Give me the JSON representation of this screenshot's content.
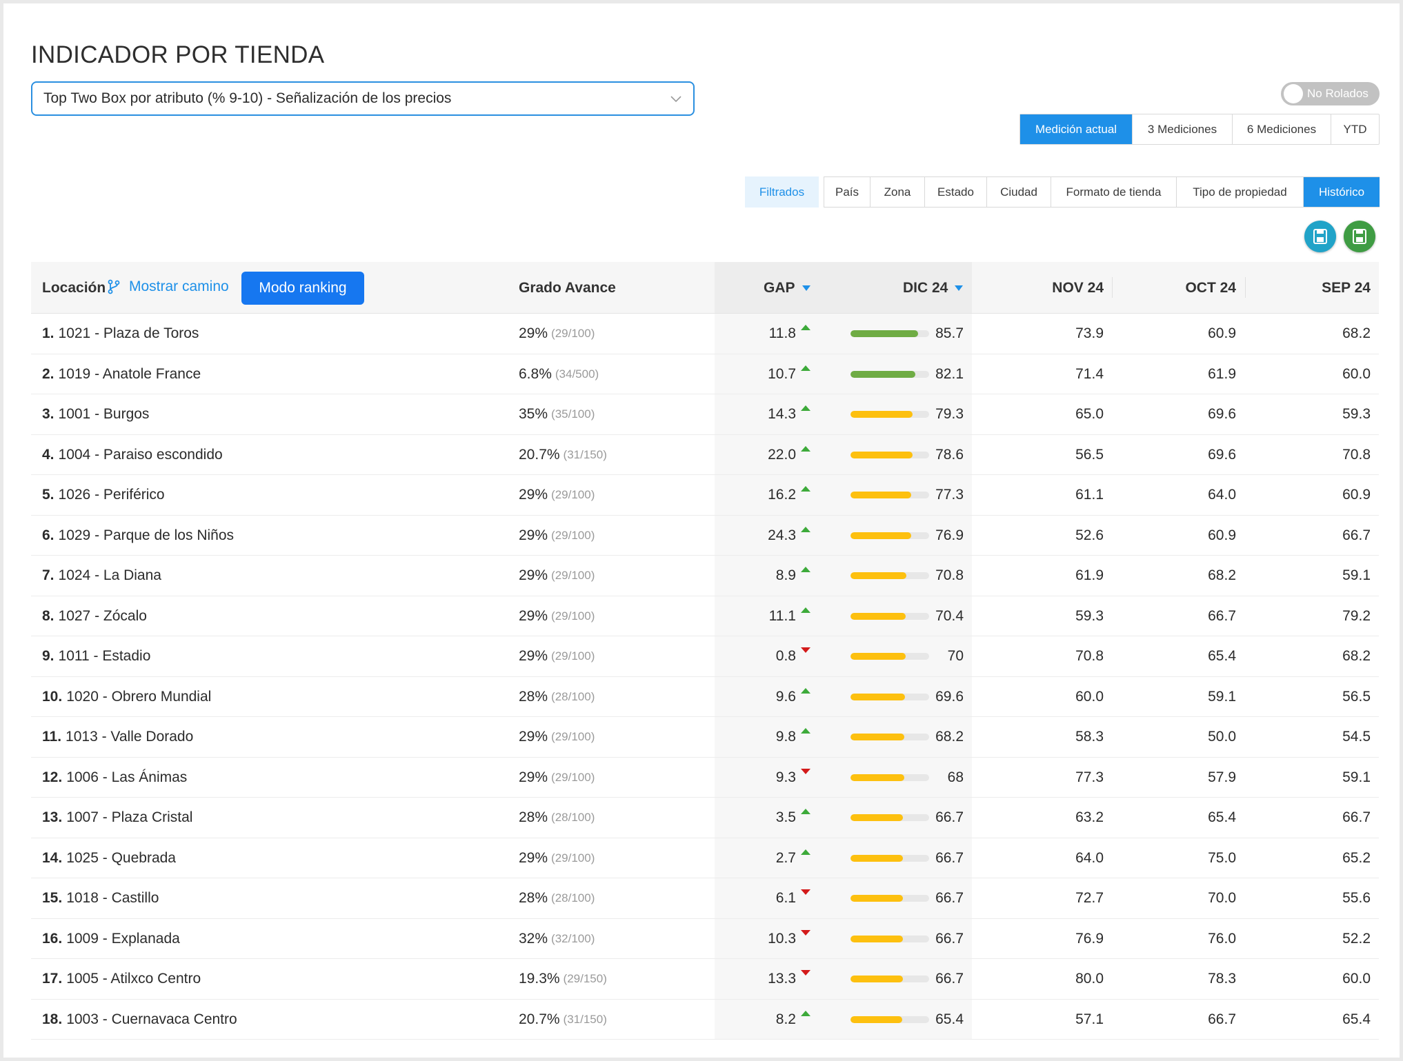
{
  "title": "INDICADOR POR TIENDA",
  "selector": {
    "value": "Top Two Box por atributo (% 9-10) - Señalización de los precios"
  },
  "toggle": {
    "label": "No Rolados",
    "on": false
  },
  "period_tabs": [
    {
      "label": "Medición actual",
      "active": true
    },
    {
      "label": "3 Mediciones",
      "active": false
    },
    {
      "label": "6 Mediciones",
      "active": false
    },
    {
      "label": "YTD",
      "active": false
    }
  ],
  "filter_tabs": [
    {
      "label": "Filtrados",
      "style": "light"
    },
    {
      "label": "País"
    },
    {
      "label": "Zona"
    },
    {
      "label": "Estado"
    },
    {
      "label": "Ciudad"
    },
    {
      "label": "Formato de tienda"
    },
    {
      "label": "Tipo de propiedad"
    },
    {
      "label": "Histórico",
      "style": "active"
    }
  ],
  "colors": {
    "accent": "#1e90e8",
    "bar_green": "#6fac44",
    "bar_yellow": "#fdc00f",
    "orange": "#f3b528",
    "red": "#d7261f",
    "up": "#3daa3a",
    "down": "#d31a1a"
  },
  "table": {
    "headers": {
      "location": "Locación",
      "path_link": "Mostrar camino",
      "ranking_button": "Modo ranking",
      "progress": "Grado Avance",
      "gap": "GAP",
      "current": "DIC 24",
      "m1": "NOV 24",
      "m2": "OCT 24",
      "m3": "SEP 24"
    },
    "rows": [
      {
        "rank": "1.",
        "name": "1021 - Plaza de Toros",
        "pct": "29%",
        "ratio": "(29/100)",
        "gap": "11.8",
        "dir": "up",
        "score": "85.7",
        "bar": "green",
        "nov": "73.9",
        "nov_c": "orange",
        "oct": "60.9",
        "oct_c": "orange",
        "sep": "68.2",
        "sep_c": "orange"
      },
      {
        "rank": "2.",
        "name": "1019 - Anatole France",
        "pct": "6.8%",
        "ratio": "(34/500)",
        "gap": "10.7",
        "dir": "up",
        "score": "82.1",
        "bar": "green",
        "nov": "71.4",
        "nov_c": "orange",
        "oct": "61.9",
        "oct_c": "orange",
        "sep": "60.0",
        "sep_c": "red"
      },
      {
        "rank": "3.",
        "name": "1001 - Burgos",
        "pct": "35%",
        "ratio": "(35/100)",
        "gap": "14.3",
        "dir": "up",
        "score": "79.3",
        "bar": "yellow",
        "nov": "65.0",
        "nov_c": "orange",
        "oct": "69.6",
        "oct_c": "orange",
        "sep": "59.3",
        "sep_c": "red"
      },
      {
        "rank": "4.",
        "name": "1004 - Paraiso escondido",
        "pct": "20.7%",
        "ratio": "(31/150)",
        "gap": "22.0",
        "dir": "up",
        "score": "78.6",
        "bar": "yellow",
        "nov": "56.5",
        "nov_c": "red",
        "oct": "69.6",
        "oct_c": "orange",
        "sep": "70.8",
        "sep_c": "orange"
      },
      {
        "rank": "5.",
        "name": "1026 - Periférico",
        "pct": "29%",
        "ratio": "(29/100)",
        "gap": "16.2",
        "dir": "up",
        "score": "77.3",
        "bar": "yellow",
        "nov": "61.1",
        "nov_c": "orange",
        "oct": "64.0",
        "oct_c": "orange",
        "sep": "60.9",
        "sep_c": "orange"
      },
      {
        "rank": "6.",
        "name": "1029 - Parque de los Niños",
        "pct": "29%",
        "ratio": "(29/100)",
        "gap": "24.3",
        "dir": "up",
        "score": "76.9",
        "bar": "yellow",
        "nov": "52.6",
        "nov_c": "red",
        "oct": "60.9",
        "oct_c": "orange",
        "sep": "66.7",
        "sep_c": "orange"
      },
      {
        "rank": "7.",
        "name": "1024 - La Diana",
        "pct": "29%",
        "ratio": "(29/100)",
        "gap": "8.9",
        "dir": "up",
        "score": "70.8",
        "bar": "yellow",
        "nov": "61.9",
        "nov_c": "orange",
        "oct": "68.2",
        "oct_c": "orange",
        "sep": "59.1",
        "sep_c": "red"
      },
      {
        "rank": "8.",
        "name": "1027 - Zócalo",
        "pct": "29%",
        "ratio": "(29/100)",
        "gap": "11.1",
        "dir": "up",
        "score": "70.4",
        "bar": "yellow",
        "nov": "59.3",
        "nov_c": "red",
        "oct": "66.7",
        "oct_c": "orange",
        "sep": "79.2",
        "sep_c": "orange"
      },
      {
        "rank": "9.",
        "name": "1011 - Estadio",
        "pct": "29%",
        "ratio": "(29/100)",
        "gap": "0.8",
        "dir": "down",
        "score": "70",
        "bar": "yellow",
        "nov": "70.8",
        "nov_c": "orange",
        "oct": "65.4",
        "oct_c": "orange",
        "sep": "68.2",
        "sep_c": "orange"
      },
      {
        "rank": "10.",
        "name": "1020 - Obrero Mundial",
        "pct": "28%",
        "ratio": "(28/100)",
        "gap": "9.6",
        "dir": "up",
        "score": "69.6",
        "bar": "yellow",
        "nov": "60.0",
        "nov_c": "red",
        "oct": "59.1",
        "oct_c": "red",
        "sep": "56.5",
        "sep_c": "red"
      },
      {
        "rank": "11.",
        "name": "1013 - Valle Dorado",
        "pct": "29%",
        "ratio": "(29/100)",
        "gap": "9.8",
        "dir": "up",
        "score": "68.2",
        "bar": "yellow",
        "nov": "58.3",
        "nov_c": "red",
        "oct": "50.0",
        "oct_c": "red",
        "sep": "54.5",
        "sep_c": "red"
      },
      {
        "rank": "12.",
        "name": "1006 - Las Ánimas",
        "pct": "29%",
        "ratio": "(29/100)",
        "gap": "9.3",
        "dir": "down",
        "score": "68",
        "bar": "yellow",
        "nov": "77.3",
        "nov_c": "orange",
        "oct": "57.9",
        "oct_c": "red",
        "sep": "59.1",
        "sep_c": "red"
      },
      {
        "rank": "13.",
        "name": "1007 - Plaza Cristal",
        "pct": "28%",
        "ratio": "(28/100)",
        "gap": "3.5",
        "dir": "up",
        "score": "66.7",
        "bar": "yellow",
        "nov": "63.2",
        "nov_c": "orange",
        "oct": "65.4",
        "oct_c": "orange",
        "sep": "66.7",
        "sep_c": "orange"
      },
      {
        "rank": "14.",
        "name": "1025 - Quebrada",
        "pct": "29%",
        "ratio": "(29/100)",
        "gap": "2.7",
        "dir": "up",
        "score": "66.7",
        "bar": "yellow",
        "nov": "64.0",
        "nov_c": "orange",
        "oct": "75.0",
        "oct_c": "orange",
        "sep": "65.2",
        "sep_c": "orange"
      },
      {
        "rank": "15.",
        "name": "1018 - Castillo",
        "pct": "28%",
        "ratio": "(28/100)",
        "gap": "6.1",
        "dir": "down",
        "score": "66.7",
        "bar": "yellow",
        "nov": "72.7",
        "nov_c": "orange",
        "oct": "70.0",
        "oct_c": "orange",
        "sep": "55.6",
        "sep_c": "red"
      },
      {
        "rank": "16.",
        "name": "1009 - Explanada",
        "pct": "32%",
        "ratio": "(32/100)",
        "gap": "10.3",
        "dir": "down",
        "score": "66.7",
        "bar": "yellow",
        "nov": "76.9",
        "nov_c": "orange",
        "oct": "76.0",
        "oct_c": "orange",
        "sep": "52.2",
        "sep_c": "red"
      },
      {
        "rank": "17.",
        "name": "1005 - Atilxco Centro",
        "pct": "19.3%",
        "ratio": "(29/150)",
        "gap": "13.3",
        "dir": "down",
        "score": "66.7",
        "bar": "yellow",
        "nov": "80.0",
        "nov_c": "orange",
        "oct": "78.3",
        "oct_c": "orange",
        "sep": "60.0",
        "sep_c": "red"
      },
      {
        "rank": "18.",
        "name": "1003 - Cuernavaca Centro",
        "pct": "20.7%",
        "ratio": "(31/150)",
        "gap": "8.2",
        "dir": "up",
        "score": "65.4",
        "bar": "yellow",
        "nov": "57.1",
        "nov_c": "red",
        "oct": "66.7",
        "oct_c": "orange",
        "sep": "65.4",
        "sep_c": "orange"
      }
    ]
  }
}
